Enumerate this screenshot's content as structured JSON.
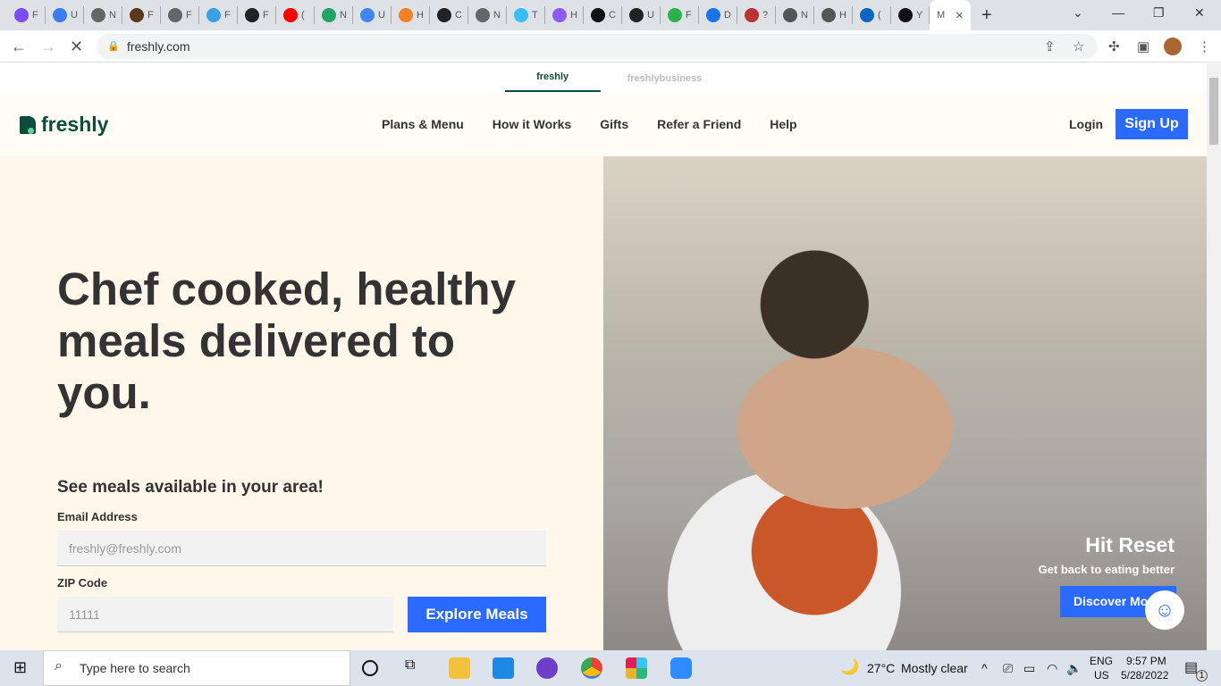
{
  "browser": {
    "tabs": [
      "F",
      "U",
      "N",
      "F",
      "F",
      "F",
      "F",
      "(",
      "N",
      "U",
      "H",
      "C",
      "N",
      "T",
      "H",
      "C",
      "U",
      "F",
      "D",
      "?",
      "N",
      "H",
      "(",
      "Y"
    ],
    "tab_colors": [
      "#7b4cf5",
      "#3b7cf5",
      "#666",
      "#5a3a1a",
      "#666",
      "#3aa0e8",
      "#222",
      "#f00",
      "#1fa463",
      "#4285f4",
      "#f48024",
      "#222",
      "#666",
      "#38bdf8",
      "#8b5cf6",
      "#111",
      "#222",
      "#2cb34a",
      "#1a73e8",
      "#b33",
      "#555",
      "#555",
      "#0a66c2",
      "#111"
    ],
    "active_tab": "M",
    "url": "freshly.com"
  },
  "page": {
    "brands": [
      "freshly",
      "freshlybusiness"
    ],
    "logo": "freshly",
    "menu": [
      "Plans & Menu",
      "How it Works",
      "Gifts",
      "Refer a Friend",
      "Help"
    ],
    "login": "Login",
    "signup": "Sign Up",
    "headline": "Chef cooked, healthy meals delivered to you.",
    "subheading": "See meals available in your area!",
    "email_label": "Email Address",
    "email_placeholder": "freshly@freshly.com",
    "zip_label": "ZIP Code",
    "zip_placeholder": "11111",
    "explore": "Explore Meals",
    "hero_title": "Hit Reset",
    "hero_sub": "Get back to eating better",
    "hero_button": "Discover More",
    "accent": "#2a6aff",
    "brand_color": "#0b4d3b"
  },
  "taskbar": {
    "search": "Type here to search",
    "weather": "27°C",
    "weather_text": "Mostly clear",
    "lang1": "ENG",
    "lang2": "US",
    "time": "9:57 PM",
    "date": "5/28/2022",
    "notifications": "1"
  }
}
